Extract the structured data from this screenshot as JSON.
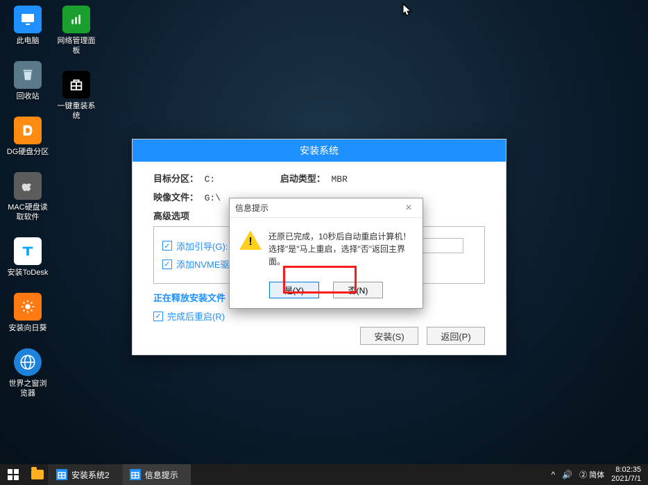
{
  "desktop": {
    "col1": [
      {
        "name": "pc",
        "label": "此电脑"
      },
      {
        "name": "bin",
        "label": "回收站"
      },
      {
        "name": "dg",
        "label": "DG硬盘分区"
      },
      {
        "name": "mac",
        "label": "MAC硬盘读取软件"
      },
      {
        "name": "todesk",
        "label": "安装ToDesk"
      },
      {
        "name": "sun",
        "label": "安装向日葵"
      },
      {
        "name": "globe",
        "label": "世界之窗浏览器"
      }
    ],
    "col2": [
      {
        "name": "net",
        "label": "网络管理面板"
      },
      {
        "name": "reinstall",
        "label": "一键重装系统"
      }
    ]
  },
  "installer": {
    "title": "安装系统",
    "target_label": "目标分区：",
    "target_value": "C:",
    "boot_label": "启动类型：",
    "boot_value": "MBR",
    "image_label": "映像文件：",
    "image_value": "G:\\",
    "adv_title": "高级选项",
    "chk_boot": "添加引导(G):",
    "chk_nvme": "添加NVME驱",
    "progress_text": "正在释放安装文件",
    "chk_restart": "完成后重启(R)",
    "btn_install": "安装(S)",
    "btn_back": "返回(P)"
  },
  "modal": {
    "title": "信息提示",
    "line1": "还原已完成，10秒后自动重启计算机！",
    "line2": "选择\"是\"马上重启，选择\"否\"返回主界面。",
    "btn_yes": "是(Y)",
    "btn_no": "否(N)"
  },
  "taskbar": {
    "item1": "安装系统2",
    "item2": "信息提示",
    "chevron": "^",
    "speaker": "🔊",
    "ime1": "简体",
    "ime2": "②",
    "time": "8:02:35",
    "date": "2021/7/1"
  }
}
